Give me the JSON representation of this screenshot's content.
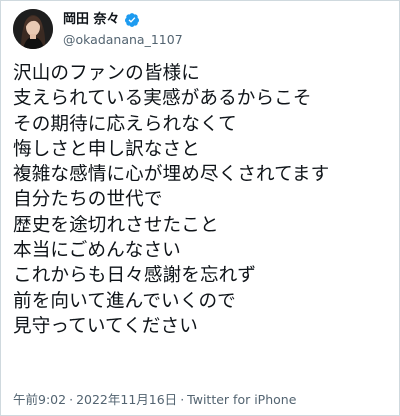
{
  "tweet": {
    "author": {
      "display_name": "岡田 奈々",
      "handle": "@okadanana_1107",
      "verified_icon": "verified-badge-icon",
      "avatar_icon": "profile-photo"
    },
    "lines": [
      "沢山のファンの皆様に",
      "支えられている実感があるからこそ",
      "その期待に応えられなくて",
      "悔しさと申し訳なさと",
      "複雑な感情に心が埋め尽くされてます",
      "自分たちの世代で",
      "歴史を途切れさせたこと",
      "本当にごめんなさい",
      "これからも日々感謝を忘れず",
      "前を向いて進んでいくので",
      "見守っていてください"
    ],
    "time": "午前9:02",
    "separator": "·",
    "date": "2022年11月16日",
    "source": "Twitter for iPhone"
  },
  "colors": {
    "text": "#0f1419",
    "secondary": "#536471",
    "verified": "#1d9bf0",
    "border": "#cfd9de"
  }
}
